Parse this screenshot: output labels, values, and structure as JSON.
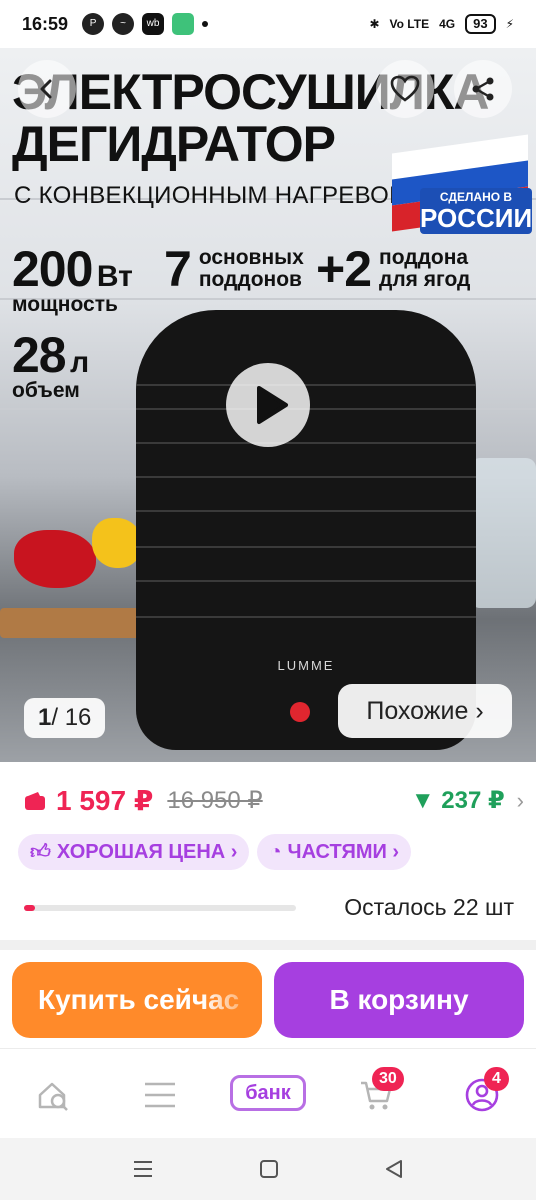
{
  "status_bar": {
    "time": "16:59",
    "network": "4G",
    "battery": "93"
  },
  "hero": {
    "title_line1": "ЭЛЕКТРОСУШИЛКА",
    "title_line2": "ДЕГИДРАТОР",
    "subtitle": "С КОНВЕКЦИОННЫМ НАГРЕВОМ",
    "flag_top": "СДЕЛАНО В",
    "flag_bottom": "РОССИИ",
    "power_value": "200",
    "power_unit": "Вт",
    "power_caption": "мощность",
    "trays_value": "7",
    "trays_caption_1": "основных",
    "trays_caption_2": "поддонов",
    "extra_value": "+2",
    "extra_caption_1": "поддона",
    "extra_caption_2": "для ягод",
    "volume_value": "28",
    "volume_unit": "л",
    "volume_caption": "объем",
    "brand": "LUMME",
    "counter_current": "1",
    "counter_total": "16",
    "similar_label": "Похожие ›"
  },
  "price": {
    "current": "1 597 ₽",
    "old": "16 950 ₽",
    "cashback": "▼ 237 ₽",
    "chip_good_price": "ХОРОШАЯ ЦЕНА ›",
    "chip_parts": "ЧАСТЯМИ ›",
    "stock_text": "Осталось 22 шт",
    "stock_fraction": 0.04
  },
  "actions": {
    "buy_now": "Купить сейчас",
    "add_to_cart": "В корзину"
  },
  "tabbar": {
    "bank_label": "банк",
    "cart_count": "30",
    "profile_count": "4"
  },
  "colors": {
    "accent_purple": "#a63fe0",
    "buy_orange": "#ff8a2a",
    "price_red": "#ef2454",
    "cashback_green": "#1fa05b"
  }
}
